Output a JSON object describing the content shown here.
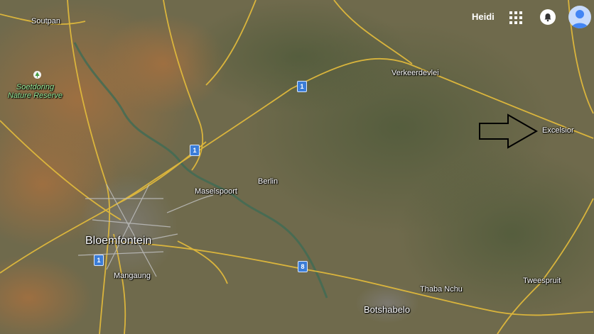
{
  "header": {
    "user_name": "Heidi",
    "icons": [
      "apps-grid-icon",
      "notifications-bell-icon",
      "account-avatar-icon"
    ]
  },
  "places": {
    "soutpan": "Soutpan",
    "soetdoring": "Soetdoring\nNature Reserve",
    "verkeerdevlei": "Verkeerdevlei",
    "excelsior": "Excelsior",
    "maselspoort": "Maselspoort",
    "berlin": "Berlin",
    "bloemfontein": "Bloemfontein",
    "mangaung": "Mangaung",
    "thaba_nchu": "Thaba Nchu",
    "botshabelo": "Botshabelo",
    "tweespruit": "Tweespruit"
  },
  "route_shields": {
    "north_a": "1",
    "north_b": "1",
    "south": "1",
    "east": "8"
  },
  "colors": {
    "terrain": "#6f6a4c",
    "road": "#e0b93c",
    "river": "#3f6b55",
    "route_shield": "#3b7dd8",
    "park_label": "#9cf09c"
  }
}
